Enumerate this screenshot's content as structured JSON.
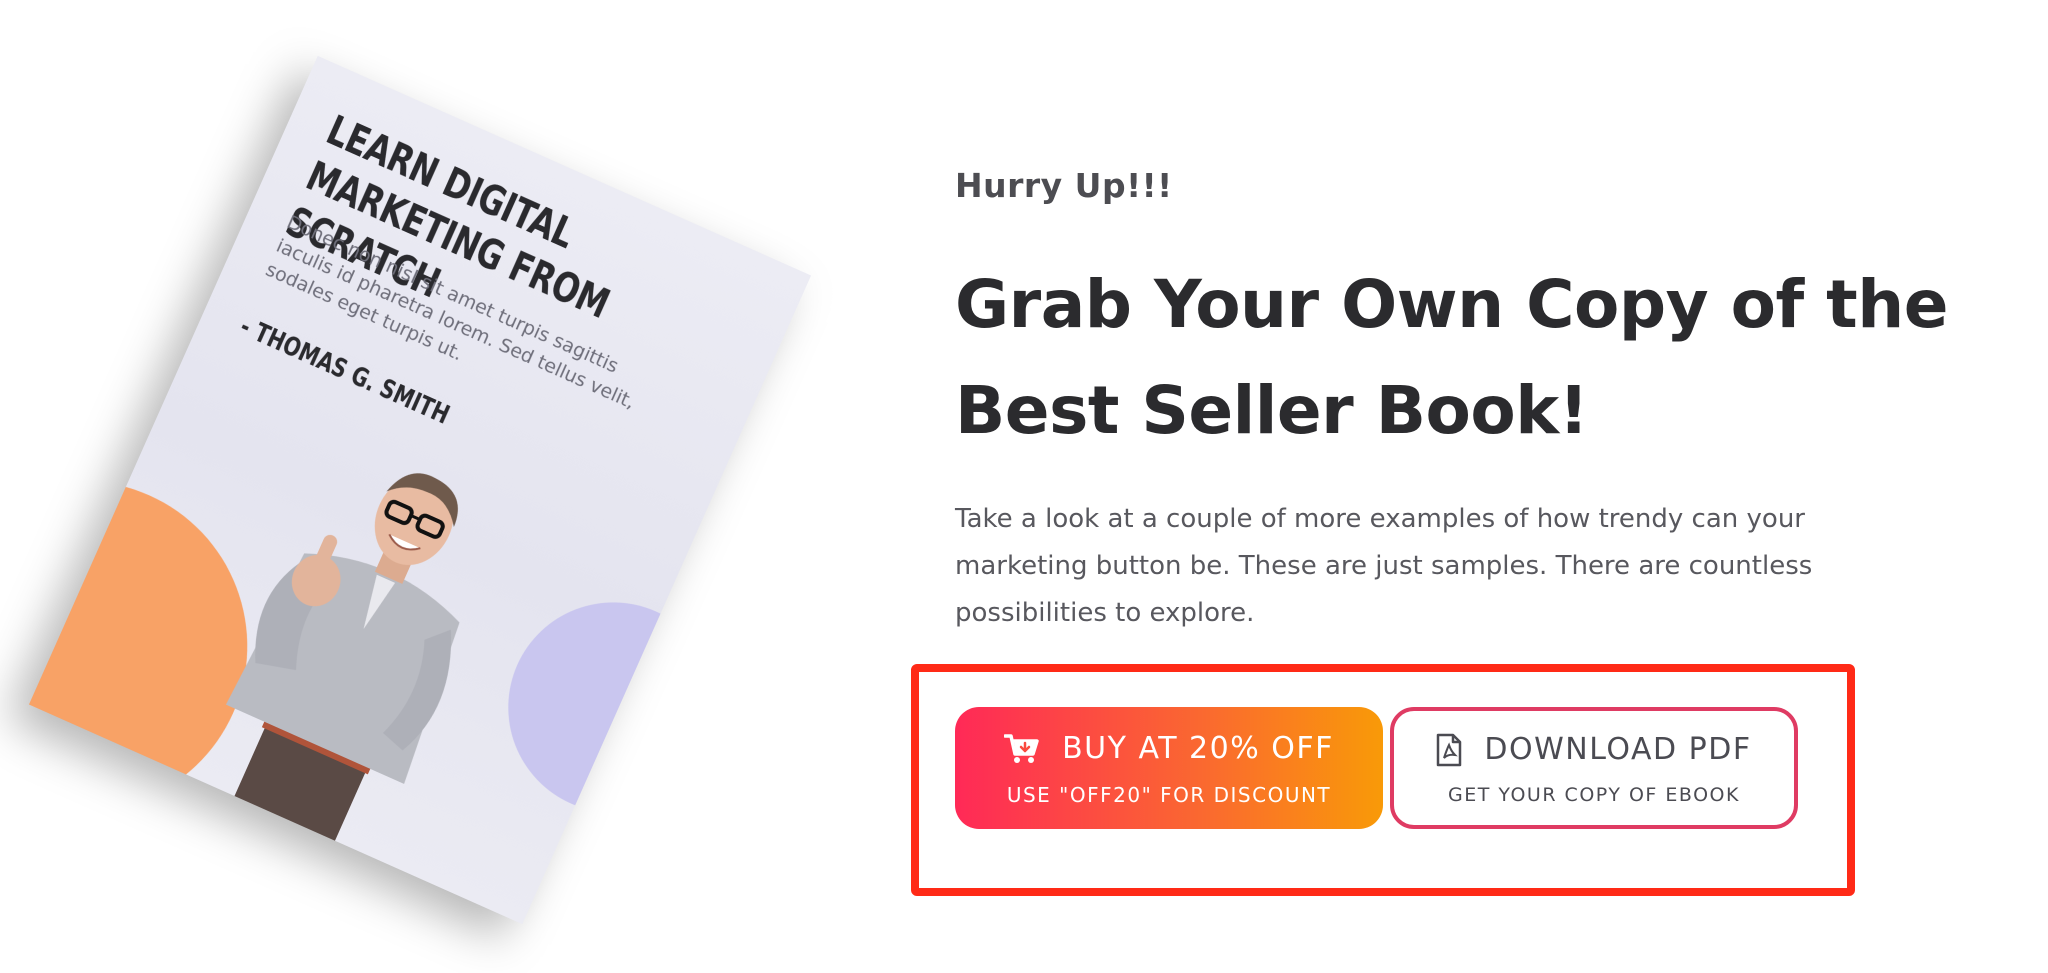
{
  "book": {
    "title": "LEARN DIGITAL MARKETING FROM SCRATCH",
    "description": "Donec non nisl sit amet turpis sagittis iaculis id pharetra lorem. Sed tellus velit, sodales eget turpis ut.",
    "author": "- THOMAS G. SMITH"
  },
  "hero": {
    "eyebrow": "Hurry Up!!!",
    "headline": "Grab Your Own Copy of the Best Seller Book!",
    "body": "Take a look at a couple of more examples of how trendy can your marketing button be. These are just samples. There are countless possibilities to explore."
  },
  "buttons": {
    "buy": {
      "icon": "cart-icon",
      "label": "BUY AT 20% OFF",
      "sublabel": "USE \"OFF20\" FOR DISCOUNT"
    },
    "download": {
      "icon": "pdf-icon",
      "label": "DOWNLOAD PDF",
      "sublabel": "GET YOUR COPY OF EBOOK"
    }
  },
  "colors": {
    "highlight_border": "#ff2a17",
    "buy_gradient_start": "#ff2957",
    "buy_gradient_end": "#f99a08",
    "download_border": "#df3b63",
    "book_orange": "#f8a266",
    "book_purple": "#c9c6ef"
  }
}
